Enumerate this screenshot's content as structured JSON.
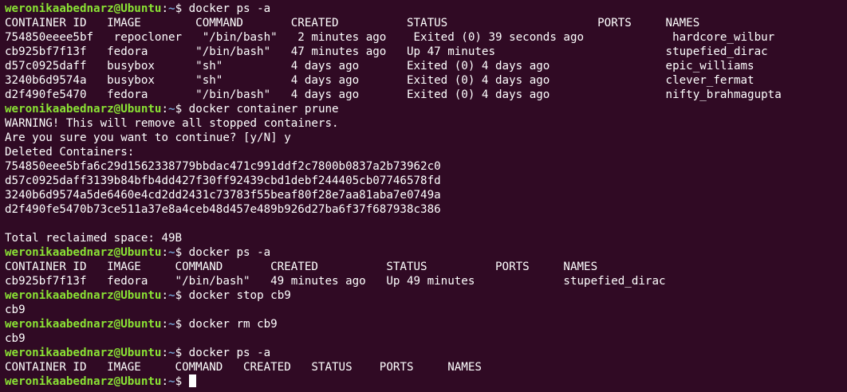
{
  "colors": {
    "background": "#300a24",
    "foreground": "#ffffff",
    "prompt_user": "#8ae234",
    "prompt_path": "#729fcf"
  },
  "prompt": {
    "user_host": "weronikaabednarz@Ubuntu",
    "separator": ":",
    "path": "~",
    "symbol": "$ "
  },
  "lines": [
    {
      "type": "prompt",
      "command": "docker ps -a"
    },
    {
      "type": "output",
      "text": "CONTAINER ID   IMAGE        COMMAND       CREATED          STATUS                      PORTS     NAMES"
    },
    {
      "type": "output",
      "text": "754850eeee5bf   repocloner   \"/bin/bash\"   2 minutes ago    Exited (0) 39 seconds ago             hardcore_wilbur"
    },
    {
      "type": "output",
      "text": "cb925bf7f13f   fedora       \"/bin/bash\"   47 minutes ago   Up 47 minutes                         stupefied_dirac"
    },
    {
      "type": "output",
      "text": "d57c0925daff   busybox      \"sh\"          4 days ago       Exited (0) 4 days ago                 epic_williams"
    },
    {
      "type": "output",
      "text": "3240b6d9574a   busybox      \"sh\"          4 days ago       Exited (0) 4 days ago                 clever_fermat"
    },
    {
      "type": "output",
      "text": "d2f490fe5470   fedora       \"/bin/bash\"   4 days ago       Exited (0) 4 days ago                 nifty_brahmagupta"
    },
    {
      "type": "prompt",
      "command": "docker container prune"
    },
    {
      "type": "output",
      "text": "WARNING! This will remove all stopped containers."
    },
    {
      "type": "output",
      "text": "Are you sure you want to continue? [y/N] y"
    },
    {
      "type": "output",
      "text": "Deleted Containers:"
    },
    {
      "type": "output",
      "text": "754850eee5bfa6c29d1562338779bbdac471c991ddf2c7800b0837a2b73962c0"
    },
    {
      "type": "output",
      "text": "d57c0925daff3139b84bfb4dd427f30ff92439cbd1debf244405cb07746578fd"
    },
    {
      "type": "output",
      "text": "3240b6d9574a5de6460e4cd2dd2431c73783f55beaf80f28e7aa81aba7e0749a"
    },
    {
      "type": "output",
      "text": "d2f490fe5470b73ce511a37e8a4ceb48d457e489b926d27ba6f37f687938c386"
    },
    {
      "type": "output",
      "text": ""
    },
    {
      "type": "output",
      "text": "Total reclaimed space: 49B"
    },
    {
      "type": "prompt",
      "command": "docker ps -a"
    },
    {
      "type": "output",
      "text": "CONTAINER ID   IMAGE     COMMAND       CREATED          STATUS          PORTS     NAMES"
    },
    {
      "type": "output",
      "text": "cb925bf7f13f   fedora    \"/bin/bash\"   49 minutes ago   Up 49 minutes             stupefied_dirac"
    },
    {
      "type": "prompt",
      "command": "docker stop cb9"
    },
    {
      "type": "output",
      "text": "cb9"
    },
    {
      "type": "prompt",
      "command": "docker rm cb9"
    },
    {
      "type": "output",
      "text": "cb9"
    },
    {
      "type": "prompt",
      "command": "docker ps -a"
    },
    {
      "type": "output",
      "text": "CONTAINER ID   IMAGE     COMMAND   CREATED   STATUS    PORTS     NAMES"
    },
    {
      "type": "prompt",
      "command": "",
      "cursor": true
    }
  ]
}
